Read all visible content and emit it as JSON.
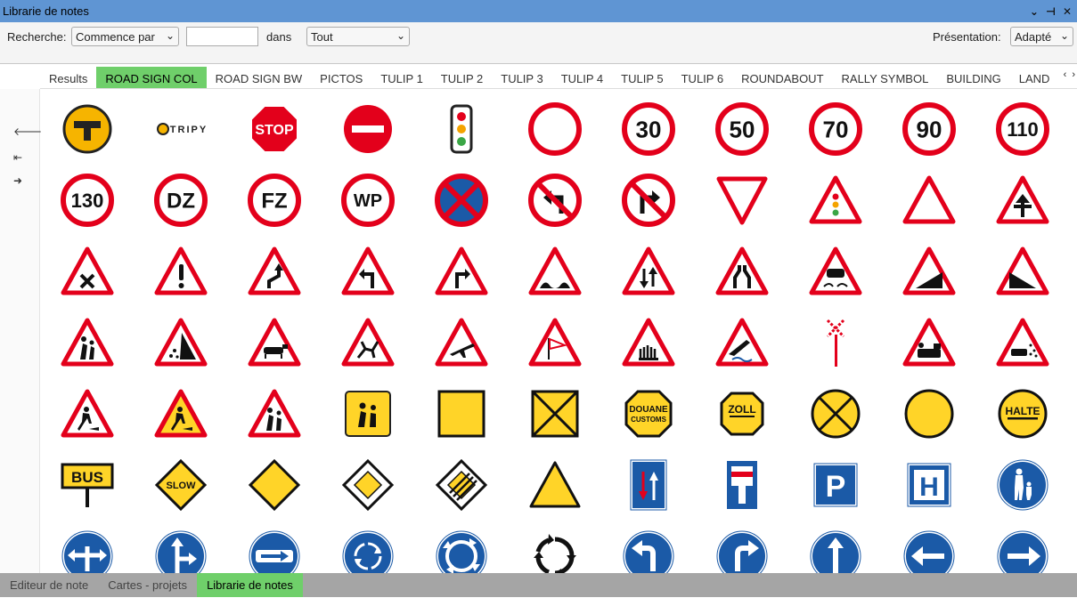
{
  "window": {
    "title": "Librarie de notes"
  },
  "toolbar": {
    "search_label": "Recherche:",
    "mode_value": "Commence par",
    "search_value": "",
    "in_label": "dans",
    "scope_value": "Tout",
    "presentation_label": "Présentation:",
    "presentation_value": "Adapté"
  },
  "tabs": [
    "Results",
    "ROAD SIGN COL",
    "ROAD SIGN BW",
    "PICTOS",
    "TULIP 1",
    "TULIP 2",
    "TULIP 3",
    "TULIP 4",
    "TULIP 5",
    "TULIP 6",
    "ROUNDABOUT",
    "RALLY SYMBOL",
    "BUILDING",
    "LAND"
  ],
  "active_tab": 1,
  "bottom_tabs": [
    "Editeur de note",
    "Cartes - projets",
    "Librarie de notes"
  ],
  "active_bottom_tab": 2,
  "colors": {
    "accent_green": "#6fcf6a",
    "titlebar_blue": "#5f95d3",
    "sign_red": "#e3001b",
    "sign_blue": "#1b5aa7",
    "sign_yellow": "#ffd428"
  },
  "icons": [
    [
      {
        "name": "tripy-logo-icon"
      },
      {
        "name": "tripy-wordmark-icon",
        "text": "TRIPY"
      },
      {
        "name": "stop-sign-icon",
        "text": "STOP"
      },
      {
        "name": "no-entry-sign-icon"
      },
      {
        "name": "traffic-light-icon"
      },
      {
        "name": "prohibited-sign-icon"
      },
      {
        "name": "speed-limit-30-icon",
        "text": "30"
      },
      {
        "name": "speed-limit-50-icon",
        "text": "50"
      },
      {
        "name": "speed-limit-70-icon",
        "text": "70"
      },
      {
        "name": "speed-limit-90-icon",
        "text": "90"
      },
      {
        "name": "speed-limit-110-icon",
        "text": "110"
      }
    ],
    [
      {
        "name": "speed-limit-130-icon",
        "text": "130"
      },
      {
        "name": "dz-sign-icon",
        "text": "DZ"
      },
      {
        "name": "fz-sign-icon",
        "text": "FZ"
      },
      {
        "name": "wp-sign-icon",
        "text": "WP"
      },
      {
        "name": "no-stopping-sign-icon"
      },
      {
        "name": "no-left-turn-icon"
      },
      {
        "name": "no-right-turn-icon"
      },
      {
        "name": "yield-sign-icon"
      },
      {
        "name": "warning-traffic-light-icon"
      },
      {
        "name": "warning-blank-icon"
      },
      {
        "name": "warning-priority-road-icon"
      }
    ],
    [
      {
        "name": "warning-crossroads-icon"
      },
      {
        "name": "warning-danger-icon"
      },
      {
        "name": "warning-double-bend-icon"
      },
      {
        "name": "warning-left-bend-icon"
      },
      {
        "name": "warning-right-bend-icon"
      },
      {
        "name": "warning-bumpy-road-icon"
      },
      {
        "name": "warning-two-way-icon"
      },
      {
        "name": "warning-road-narrows-icon"
      },
      {
        "name": "warning-slippery-icon"
      },
      {
        "name": "warning-descent-icon"
      },
      {
        "name": "warning-ascent-icon"
      }
    ],
    [
      {
        "name": "warning-children-icon"
      },
      {
        "name": "warning-falling-rocks-icon"
      },
      {
        "name": "warning-cattle-icon"
      },
      {
        "name": "warning-deer-icon"
      },
      {
        "name": "warning-aircraft-icon"
      },
      {
        "name": "warning-crosswind-icon"
      },
      {
        "name": "warning-level-crossing-icon"
      },
      {
        "name": "warning-quay-icon"
      },
      {
        "name": "railway-crossing-post-icon"
      },
      {
        "name": "warning-train-icon"
      },
      {
        "name": "warning-gravel-icon"
      }
    ],
    [
      {
        "name": "warning-roadworks-icon"
      },
      {
        "name": "warning-roadworks-yellow-icon"
      },
      {
        "name": "warning-pedestrians-icon"
      },
      {
        "name": "school-bus-sign-icon"
      },
      {
        "name": "yellow-square-icon"
      },
      {
        "name": "yellow-square-cross-icon"
      },
      {
        "name": "douane-customs-icon",
        "text": "DOUANE",
        "text2": "CUSTOMS"
      },
      {
        "name": "zoll-sign-icon",
        "text": "ZOLL"
      },
      {
        "name": "yellow-circle-cross-icon"
      },
      {
        "name": "yellow-circle-icon"
      },
      {
        "name": "halte-sign-icon",
        "text": "HALTE"
      }
    ],
    [
      {
        "name": "bus-stop-sign-icon",
        "text": "BUS"
      },
      {
        "name": "slow-sign-icon",
        "text": "SLOW"
      },
      {
        "name": "yellow-diamond-icon"
      },
      {
        "name": "priority-road-icon"
      },
      {
        "name": "end-priority-road-icon"
      },
      {
        "name": "yellow-triangle-icon"
      },
      {
        "name": "one-way-both-directions-icon"
      },
      {
        "name": "dead-end-sign-icon"
      },
      {
        "name": "parking-sign-icon",
        "text": "P"
      },
      {
        "name": "hospital-sign-icon",
        "text": "H"
      },
      {
        "name": "pedestrian-path-icon"
      }
    ],
    [
      {
        "name": "mandatory-left-right-icon"
      },
      {
        "name": "mandatory-straight-right-icon"
      },
      {
        "name": "mandatory-right-bar-icon"
      },
      {
        "name": "roundabout-sign-icon"
      },
      {
        "name": "roundabout-sign-alt-icon"
      },
      {
        "name": "roundabout-arrows-icon"
      },
      {
        "name": "mandatory-turn-left-icon"
      },
      {
        "name": "mandatory-turn-right-icon"
      },
      {
        "name": "mandatory-straight-icon"
      },
      {
        "name": "mandatory-left-icon"
      },
      {
        "name": "mandatory-right-icon"
      }
    ]
  ]
}
